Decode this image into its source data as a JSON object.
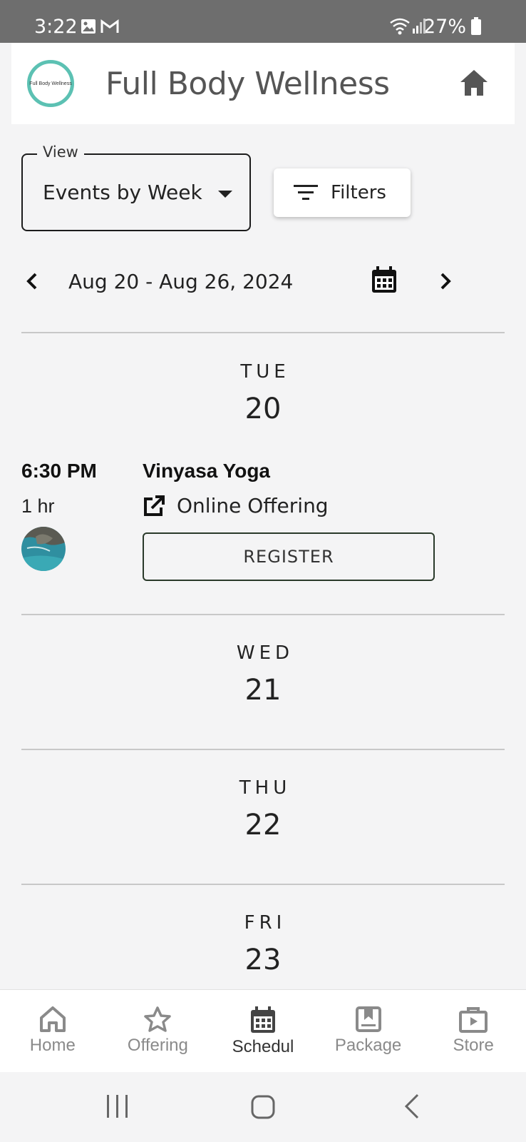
{
  "status_bar": {
    "time": "3:22",
    "battery": "27%",
    "icons": [
      "image-notification-icon",
      "gmail-icon",
      "wifi-icon",
      "signal-icon",
      "battery-icon"
    ]
  },
  "header": {
    "logo_text": "Full Body Wellness",
    "title": "Full Body Wellness"
  },
  "view": {
    "legend": "View",
    "value": "Events by Week"
  },
  "filters": {
    "label": "Filters"
  },
  "week": {
    "range": "Aug 20 - Aug 26, 2024"
  },
  "days": [
    {
      "dow": "TUE",
      "num": "20"
    },
    {
      "dow": "WED",
      "num": "21"
    },
    {
      "dow": "THU",
      "num": "22"
    },
    {
      "dow": "FRI",
      "num": "23"
    }
  ],
  "event": {
    "time": "6:30 PM",
    "duration": "1 hr",
    "name": "Vinyasa Yoga",
    "location": "Online Offering",
    "register_label": "REGISTER"
  },
  "bottom_nav": [
    {
      "label": "Home",
      "icon": "home-icon",
      "active": false
    },
    {
      "label": "Offering",
      "icon": "star-icon",
      "active": false
    },
    {
      "label": "Schedul",
      "icon": "calendar-icon",
      "active": true
    },
    {
      "label": "Package",
      "icon": "bookmark-icon",
      "active": false
    },
    {
      "label": "Store",
      "icon": "store-icon",
      "active": false
    }
  ],
  "colors": {
    "status_bar": "#6e6e6e",
    "logo_ring": "#5cc1b3",
    "background": "#f4f4f5",
    "nav_inactive": "#8a8a8a",
    "nav_active": "#333333"
  }
}
